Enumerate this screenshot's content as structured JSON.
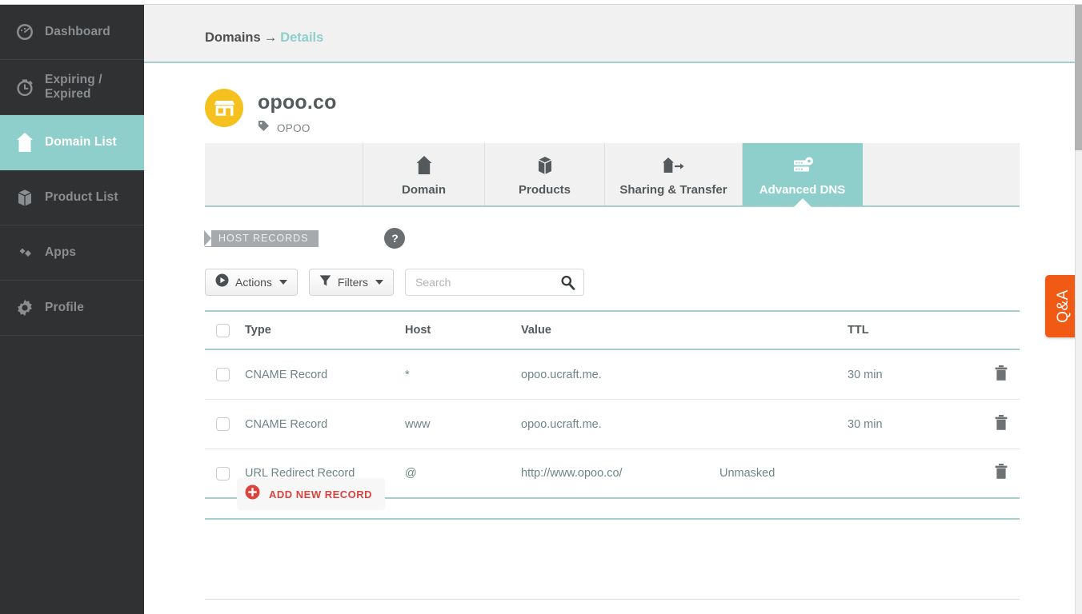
{
  "sidebar": {
    "items": [
      {
        "label": "Dashboard",
        "icon": "gauge-icon",
        "active": false
      },
      {
        "label": "Expiring / Expired",
        "icon": "clock-icon",
        "active": false
      },
      {
        "label": "Domain List",
        "icon": "house-icon",
        "active": true
      },
      {
        "label": "Product List",
        "icon": "box-icon",
        "active": false
      },
      {
        "label": "Apps",
        "icon": "apps-icon",
        "active": false
      },
      {
        "label": "Profile",
        "icon": "gear-icon",
        "active": false
      }
    ]
  },
  "header": {
    "breadcrumb_root": "Domains",
    "breadcrumb_separator": "→",
    "breadcrumb_current": "Details"
  },
  "domain": {
    "name": "opoo.co",
    "avatar_icon": "store-icon",
    "tag_icon": "tag-icon",
    "tag_label": "OPOO"
  },
  "tabs": [
    {
      "label": "Domain",
      "icon": "house-icon",
      "active": false
    },
    {
      "label": "Products",
      "icon": "box-icon",
      "active": false
    },
    {
      "label": "Sharing & Transfer",
      "icon": "share-icon",
      "active": false
    },
    {
      "label": "Advanced DNS",
      "icon": "dns-server-icon",
      "active": true
    }
  ],
  "section": {
    "title": "HOST RECORDS",
    "help_label": "?"
  },
  "toolbar": {
    "actions_label": "Actions",
    "actions_icon": "play-circle-icon",
    "filters_label": "Filters",
    "filters_icon": "funnel-icon",
    "search_placeholder": "Search",
    "search_value": "",
    "search_icon": "search-icon"
  },
  "table": {
    "columns": [
      "Type",
      "Host",
      "Value",
      "TTL"
    ],
    "rows": [
      {
        "type": "CNAME Record",
        "host": "*",
        "value": "opoo.ucraft.me.",
        "extra": "",
        "ttl": "30 min"
      },
      {
        "type": "CNAME Record",
        "host": "www",
        "value": "opoo.ucraft.me.",
        "extra": "",
        "ttl": "30 min"
      },
      {
        "type": "URL Redirect Record",
        "host": "@",
        "value": "http://www.opoo.co/",
        "extra": "Unmasked",
        "ttl": ""
      }
    ],
    "delete_icon": "trash-icon"
  },
  "add_record": {
    "label": "ADD NEW RECORD",
    "icon": "plus-circle-icon"
  },
  "qa_tab": {
    "label": "Q&A"
  },
  "colors": {
    "accent_teal": "#8fcfcb",
    "sidebar_dark": "#2f3133",
    "avatar_yellow": "#f4c11e",
    "add_record_red": "#d9443f",
    "qa_orange": "#f05a14",
    "header_gray": "#f1f1f1"
  }
}
